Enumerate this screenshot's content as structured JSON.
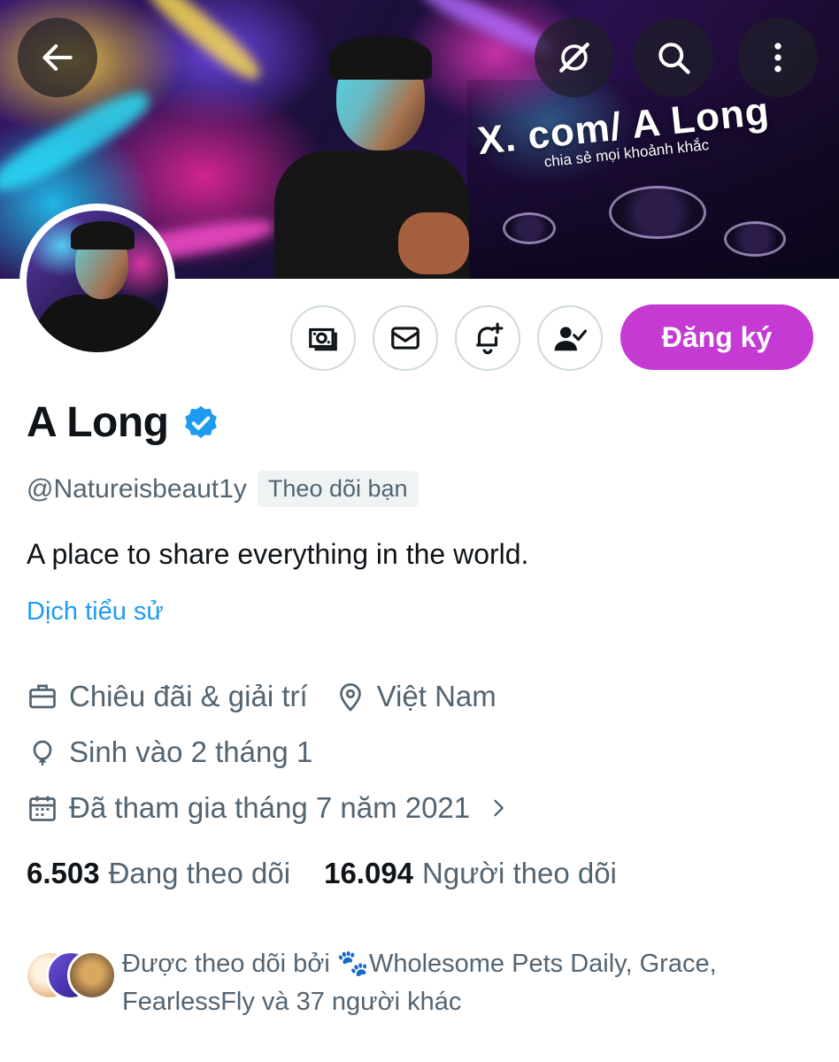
{
  "banner": {
    "headline": "X. com/ A Long",
    "tagline": "chia sẻ mọi khoảnh khắc"
  },
  "top_buttons": {
    "back_icon": "back-arrow-icon",
    "grok_icon": "grok-icon",
    "search_icon": "search-icon",
    "more_icon": "more-vertical-icon"
  },
  "actions": {
    "tip_icon": "money-icon",
    "message_icon": "envelope-icon",
    "notify_icon": "bell-plus-icon",
    "following_icon": "user-check-icon",
    "subscribe_label": "Đăng ký"
  },
  "profile": {
    "name": "A Long",
    "handle": "@Natureisbeaut1y",
    "follows_you": "Theo dõi bạn",
    "bio": "A place to share everything in the world.",
    "translate_link": "Dịch tiểu sử",
    "category": "Chiêu đãi & giải trí",
    "location": "Việt Nam",
    "birthday": "Sinh vào 2 tháng 1",
    "joined": "Đã tham gia tháng 7 năm 2021"
  },
  "stats": {
    "following_count": "6.503",
    "following_label": "Đang theo dõi",
    "followers_count": "16.094",
    "followers_label": "Người theo dõi"
  },
  "followed_by": {
    "text": "Được theo dõi bởi 🐾Wholesome Pets Daily, Grace, FearlessFly và 37 người khác"
  },
  "colors": {
    "accent_blue": "#1d9bf0",
    "subscribe_purple": "#c43ad3",
    "muted_text": "#536471"
  }
}
